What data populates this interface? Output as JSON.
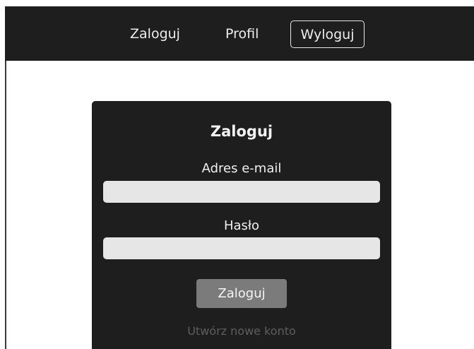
{
  "nav": {
    "login_label": "Zaloguj",
    "profile_label": "Profil",
    "logout_label": "Wyloguj"
  },
  "login_form": {
    "title": "Zaloguj",
    "email_label": "Adres e-mail",
    "email_value": "",
    "password_label": "Hasło",
    "password_value": "",
    "submit_label": "Zaloguj",
    "register_link": "Utwórz nowe konto"
  },
  "colors": {
    "navbar_bg": "#1e1e1e",
    "card_bg": "#1e1e1e",
    "input_bg": "#e6e6e6",
    "button_bg": "#7b7b7b",
    "link_color": "#5e5e5e"
  }
}
